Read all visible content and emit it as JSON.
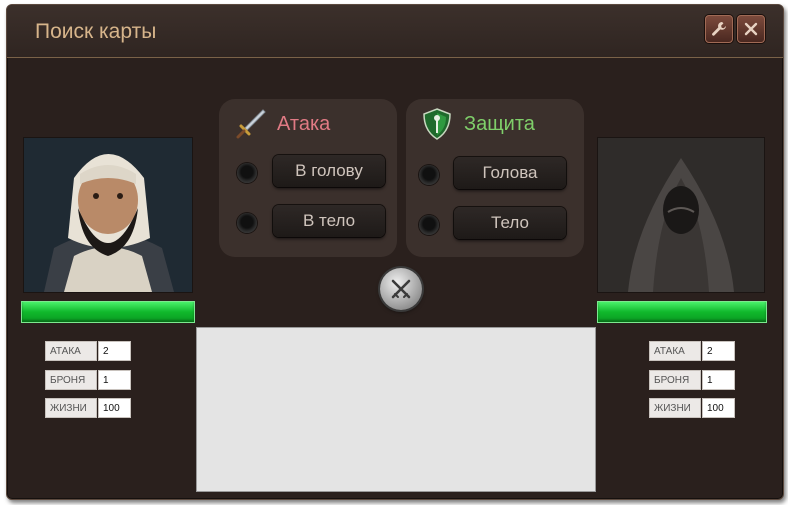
{
  "window": {
    "title": "Поиск карты",
    "settings_icon": "wrench-icon",
    "close_icon": "close-icon"
  },
  "attack": {
    "title": "Атака",
    "icon": "sword-icon",
    "options": [
      "В голову",
      "В тело"
    ]
  },
  "defense": {
    "title": "Защита",
    "icon": "shield-icon",
    "options": [
      "Голова",
      "Тело"
    ]
  },
  "fight_button_icon": "crossed-swords-icon",
  "player": {
    "portrait": "bearded-man-portrait",
    "hp_fraction": 1.0,
    "stats": [
      {
        "label": "АТАКА",
        "value": "2"
      },
      {
        "label": "БРОНЯ",
        "value": "1"
      },
      {
        "label": "ЖИЗНИ",
        "value": "100"
      }
    ]
  },
  "opponent": {
    "portrait": "hooded-figure-portrait",
    "hp_fraction": 1.0,
    "stats": [
      {
        "label": "АТАКА",
        "value": "2"
      },
      {
        "label": "БРОНЯ",
        "value": "1"
      },
      {
        "label": "ЖИЗНИ",
        "value": "100"
      }
    ]
  },
  "colors": {
    "attack_title": "#e07a84",
    "defense_title": "#7fcf6a",
    "hp_green": "#14c236",
    "title_text": "#d7b58b"
  }
}
